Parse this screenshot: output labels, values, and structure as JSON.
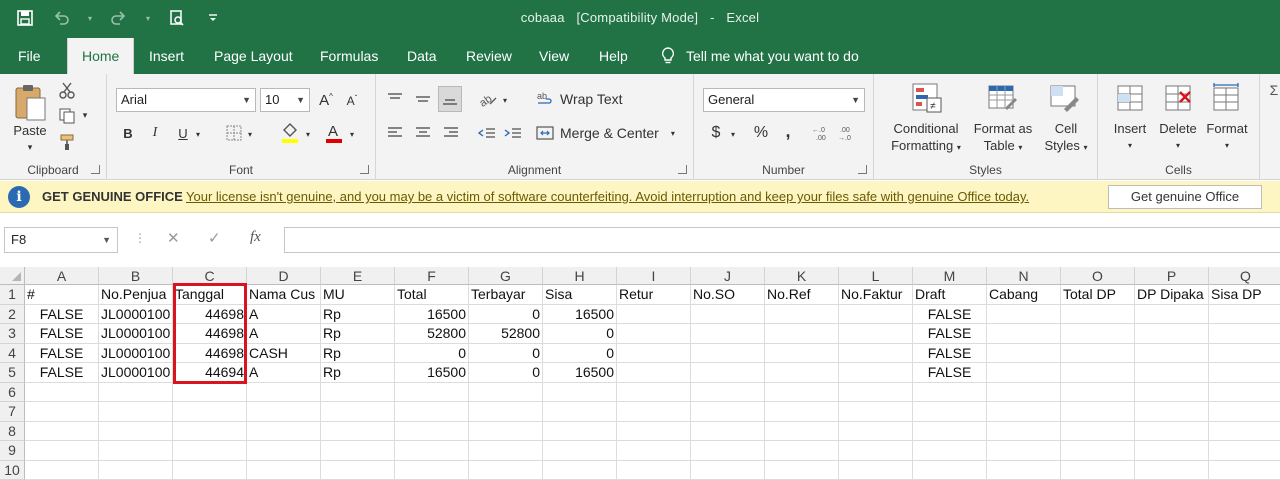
{
  "window": {
    "filename": "cobaaa",
    "mode": "[Compatibility Mode]",
    "separator": "-",
    "app": "Excel"
  },
  "qat": {
    "icons": [
      "save-icon",
      "undo-icon",
      "redo-icon",
      "print-preview-icon",
      "customize-qat-icon"
    ]
  },
  "menu": {
    "tabs": [
      "File",
      "Home",
      "Insert",
      "Page Layout",
      "Formulas",
      "Data",
      "Review",
      "View",
      "Help"
    ],
    "active": "Home",
    "tell_me": "Tell me what you want to do"
  },
  "ribbon": {
    "clipboard": {
      "label": "Clipboard",
      "paste": "Paste"
    },
    "font": {
      "label": "Font",
      "family": "Arial",
      "size": "10",
      "bold": "B",
      "italic": "I",
      "underline": "U"
    },
    "alignment": {
      "label": "Alignment",
      "wrap_text": "Wrap Text",
      "merge_center": "Merge & Center"
    },
    "number": {
      "label": "Number",
      "format": "General",
      "currency": "$",
      "percent": "%",
      "comma": ","
    },
    "styles": {
      "label": "Styles",
      "conditional_1": "Conditional",
      "conditional_2": "Formatting",
      "format_as_1": "Format as",
      "format_as_2": "Table",
      "cell_styles_1": "Cell",
      "cell_styles_2": "Styles"
    },
    "cells": {
      "label": "Cells",
      "insert": "Insert",
      "delete": "Delete",
      "format": "Format"
    }
  },
  "infobar": {
    "title": "GET GENUINE OFFICE",
    "message": "Your license isn't genuine, and you may be a victim of software counterfeiting. Avoid interruption and keep your files safe with genuine Office today.",
    "button": "Get genuine Office"
  },
  "formula_bar": {
    "name_box": "F8",
    "fx": "fx",
    "value": ""
  },
  "sheet": {
    "columns": [
      "A",
      "B",
      "C",
      "D",
      "E",
      "F",
      "G",
      "H",
      "I",
      "J",
      "K",
      "L",
      "M",
      "N",
      "O",
      "P",
      "Q"
    ],
    "rows": [
      "1",
      "2",
      "3",
      "4",
      "5",
      "6",
      "7",
      "8",
      "9",
      "10"
    ],
    "data": [
      [
        "#",
        "No.Penjua",
        "Tanggal",
        "Nama Cus",
        "MU",
        "Total",
        "Terbayar",
        "Sisa",
        "Retur",
        "No.SO",
        "No.Ref",
        "No.Faktur",
        "Draft",
        "Cabang",
        "Total DP",
        "DP Dipaka",
        "Sisa DP"
      ],
      [
        "FALSE",
        "JL0000100",
        "44698",
        "A",
        "Rp",
        "16500",
        "0",
        "16500",
        "",
        "",
        "",
        "",
        "FALSE",
        "",
        "",
        "",
        ""
      ],
      [
        "FALSE",
        "JL0000100",
        "44698",
        "A",
        "Rp",
        "52800",
        "52800",
        "0",
        "",
        "",
        "",
        "",
        "FALSE",
        "",
        "",
        "",
        ""
      ],
      [
        "FALSE",
        "JL0000100",
        "44698",
        "CASH",
        "Rp",
        "0",
        "0",
        "0",
        "",
        "",
        "",
        "",
        "FALSE",
        "",
        "",
        "",
        ""
      ],
      [
        "FALSE",
        "JL0000100",
        "44694",
        "A",
        "Rp",
        "16500",
        "0",
        "16500",
        "",
        "",
        "",
        "",
        "FALSE",
        "",
        "",
        "",
        ""
      ]
    ],
    "highlight_color": "#d9141e"
  }
}
